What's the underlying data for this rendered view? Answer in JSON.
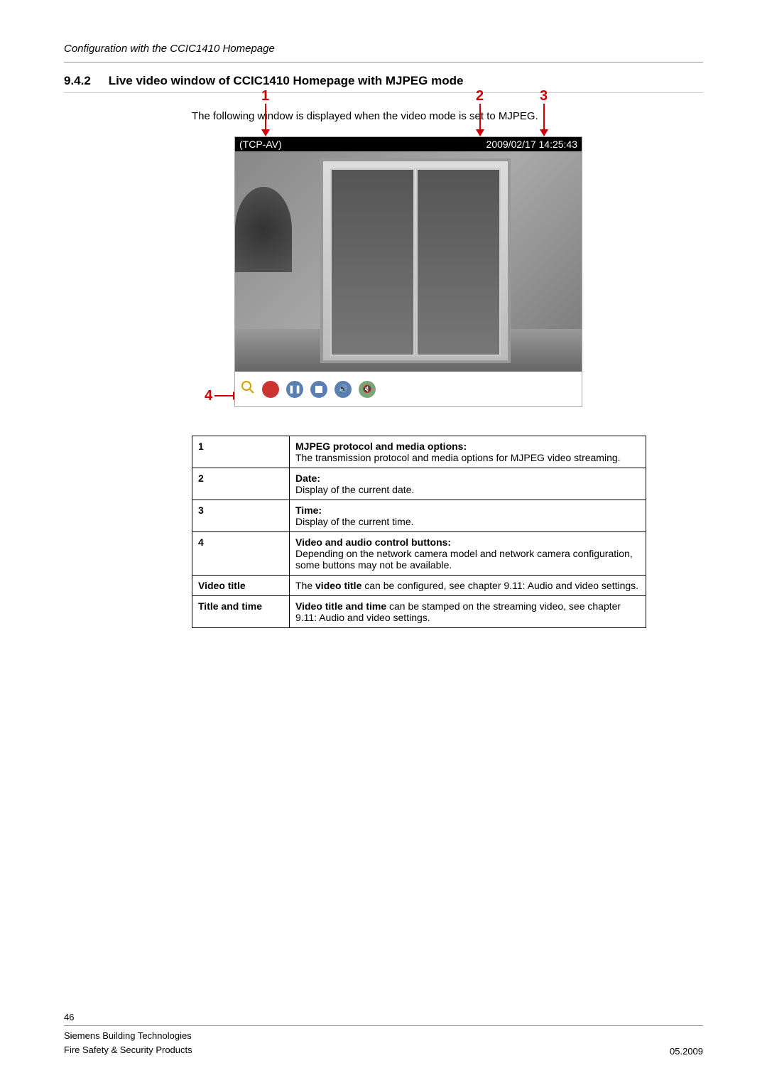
{
  "header": "Configuration with the CCIC1410 Homepage",
  "section": {
    "number": "9.4.2",
    "title": "Live video window of CCIC1410 Homepage with MJPEG mode"
  },
  "intro": "The following window is displayed when the video mode is set to MJPEG.",
  "callouts": {
    "c1": "1",
    "c2": "2",
    "c3": "3",
    "c4": "4"
  },
  "video": {
    "protocol": "(TCP-AV)",
    "date": "2009/02/17",
    "time": "14:25:43"
  },
  "icons": {
    "zoom": "zoom-icon",
    "record": "record-icon",
    "pause": "pause-icon",
    "stop": "stop-icon",
    "sound": "sound-icon",
    "mute": "mute-icon"
  },
  "table": [
    {
      "label": "1",
      "title": "MJPEG protocol and media options:",
      "desc": "The transmission protocol and media options for MJPEG video streaming."
    },
    {
      "label": "2",
      "title": "Date:",
      "desc": "Display of the current date."
    },
    {
      "label": "3",
      "title": "Time:",
      "desc": "Display of the current time."
    },
    {
      "label": "4",
      "title": "Video and audio control buttons:",
      "desc": "Depending on the network camera model and network camera configuration, some buttons may not be available."
    },
    {
      "label": "Video title",
      "title_prefix": "The ",
      "title_bold": "video title",
      "title_suffix": " can be configured, see chapter 9.11: Audio and video settings."
    },
    {
      "label": "Title and time",
      "title_bold": "Video title and time",
      "title_suffix": " can be stamped on the streaming video, see chapter 9.11: Audio and video settings."
    }
  ],
  "footer": {
    "page": "46",
    "company": "Siemens Building Technologies",
    "dept": "Fire Safety & Security Products",
    "date": "05.2009"
  }
}
